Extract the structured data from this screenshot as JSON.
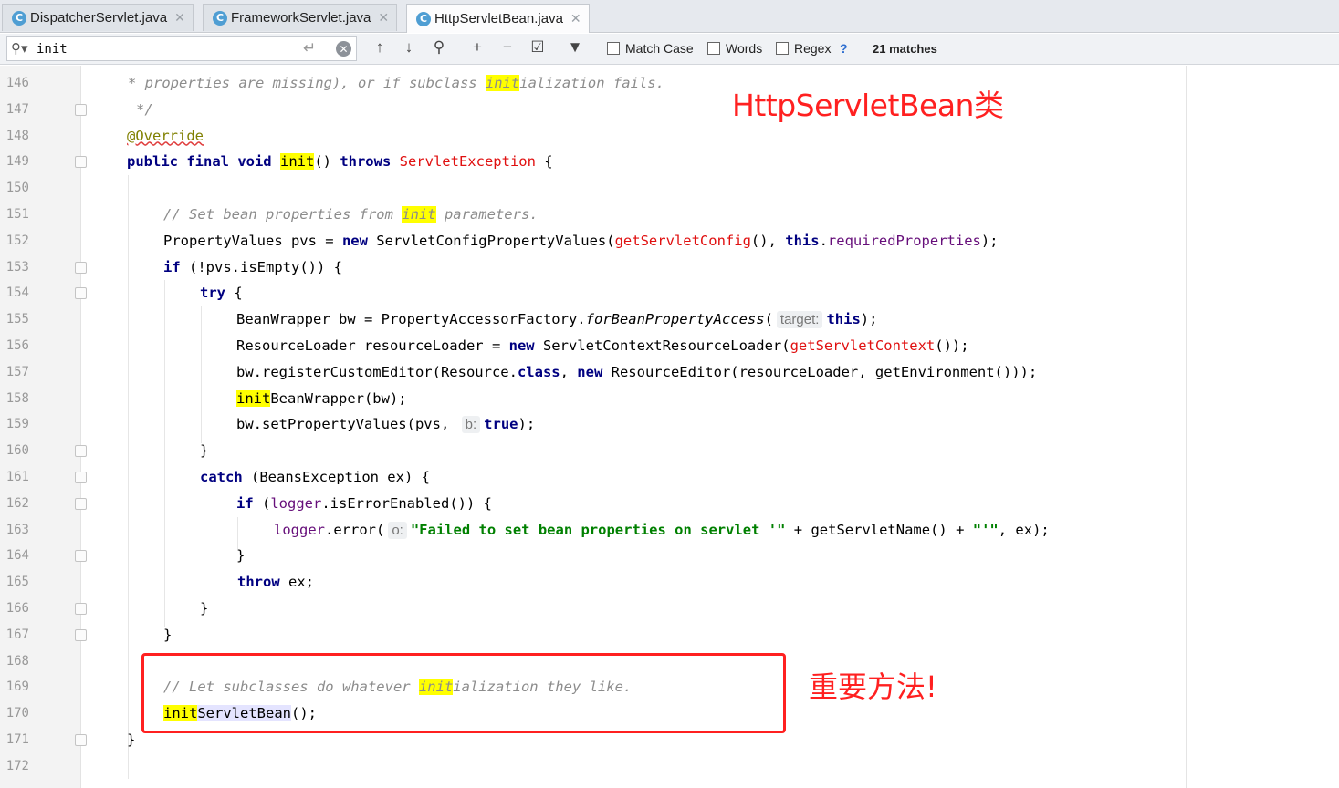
{
  "tabs": [
    {
      "icon": "C",
      "label": "DispatcherServlet.java"
    },
    {
      "icon": "C",
      "label": "FrameworkServlet.java"
    },
    {
      "icon": "C",
      "label": "HttpServletBean.java"
    }
  ],
  "find": {
    "query": "init",
    "match_case": "Match Case",
    "words": "Words",
    "regex": "Regex",
    "help": "?",
    "matches": "21 matches"
  },
  "lines": [
    "146",
    "147",
    "148",
    "149",
    "150",
    "151",
    "152",
    "153",
    "154",
    "155",
    "156",
    "157",
    "158",
    "159",
    "160",
    "161",
    "162",
    "163",
    "164",
    "165",
    "166",
    "167",
    "168",
    "169",
    "170",
    "171",
    "172"
  ],
  "code": {
    "l146_a": "* properties are missing), or if subclass ",
    "l146_hl": "init",
    "l146_b": "ialization fails.",
    "l147": "*/",
    "l148": "@Override",
    "l149_k1": "public final void ",
    "l149_hl": "init",
    "l149_a": "() ",
    "l149_k2": "throws ",
    "l149_ex": "ServletException",
    "l149_b": " {",
    "l151_a": "// Set bean properties from ",
    "l151_hl": "init",
    "l151_b": " parameters.",
    "l152_a": "PropertyValues pvs = ",
    "l152_k1": "new",
    "l152_b": " ServletConfigPropertyValues(",
    "l152_m": "getServletConfig",
    "l152_c": "(), ",
    "l152_k2": "this",
    "l152_d": ".",
    "l152_f": "requiredProperties",
    "l152_e": ");",
    "l153_k": "if",
    "l153_a": " (!pvs.isEmpty()) {",
    "l154_k": "try",
    "l154_a": " {",
    "l155_a": "BeanWrapper bw = PropertyAccessorFactory.",
    "l155_i": "forBeanPropertyAccess",
    "l155_b": "(",
    "l155_hint": "target:",
    "l155_k": "this",
    "l155_c": ");",
    "l156_a": "ResourceLoader resourceLoader = ",
    "l156_k": "new",
    "l156_b": " ServletContextResourceLoader(",
    "l156_m": "getServletContext",
    "l156_c": "());",
    "l157_a": "bw.registerCustomEditor(Resource.",
    "l157_k1": "class",
    "l157_b": ", ",
    "l157_k2": "new",
    "l157_c": " ResourceEditor(resourceLoader, getEnvironment()));",
    "l158_hl": "init",
    "l158_a": "BeanWrapper(bw);",
    "l159_a": "bw.setPropertyValues(pvs, ",
    "l159_hint": "b:",
    "l159_k": "true",
    "l159_b": ");",
    "l160": "}",
    "l161_k": "catch",
    "l161_a": " (BeansException ex) {",
    "l162_k": "if",
    "l162_a": " (",
    "l162_f": "logger",
    "l162_b": ".isErrorEnabled()) {",
    "l163_f": "logger",
    "l163_a": ".error(",
    "l163_hint": "o:",
    "l163_s": "\"Failed to set bean properties on servlet '\"",
    "l163_b": " + getServletName() + ",
    "l163_s2": "\"'\"",
    "l163_c": ", ex);",
    "l164": "}",
    "l165_k": "throw",
    "l165_a": " ex;",
    "l166": "}",
    "l167": "}",
    "l169_a": "// Let subclasses do whatever ",
    "l169_hl": "init",
    "l169_b": "ialization they like.",
    "l170_hl": "init",
    "l170_m": "ServletBean",
    "l170_a": "();",
    "l171": "}"
  },
  "annotations": {
    "title": "HttpServletBean类",
    "important": "重要方法!"
  },
  "colors": {
    "highlight": "#ffff00",
    "keyword": "#000080",
    "annotation_red": "#ff2020"
  }
}
